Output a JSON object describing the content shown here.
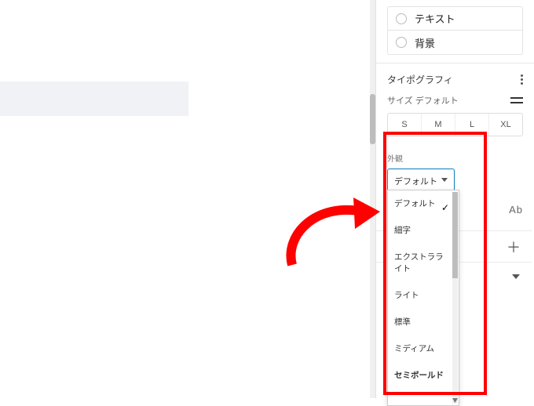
{
  "colors": {
    "text_label": "テキスト",
    "bg_label": "背景"
  },
  "typography": {
    "title": "タイポグラフィ",
    "size_label": "サイズ",
    "size_default": "デフォルト",
    "sizes": {
      "s": "S",
      "m": "M",
      "l": "L",
      "xl": "XL"
    }
  },
  "appearance": {
    "label": "外観",
    "value": "デフォルト",
    "options": [
      {
        "label": "デフォルト",
        "selected": true
      },
      {
        "label": "細字"
      },
      {
        "label": "エクストラライト"
      },
      {
        "label": "ライト"
      },
      {
        "label": "標準"
      },
      {
        "label": "ミディアム"
      },
      {
        "label": "セミボールド",
        "bold": true
      }
    ]
  },
  "misc": {
    "ab_sample": "Ab"
  }
}
